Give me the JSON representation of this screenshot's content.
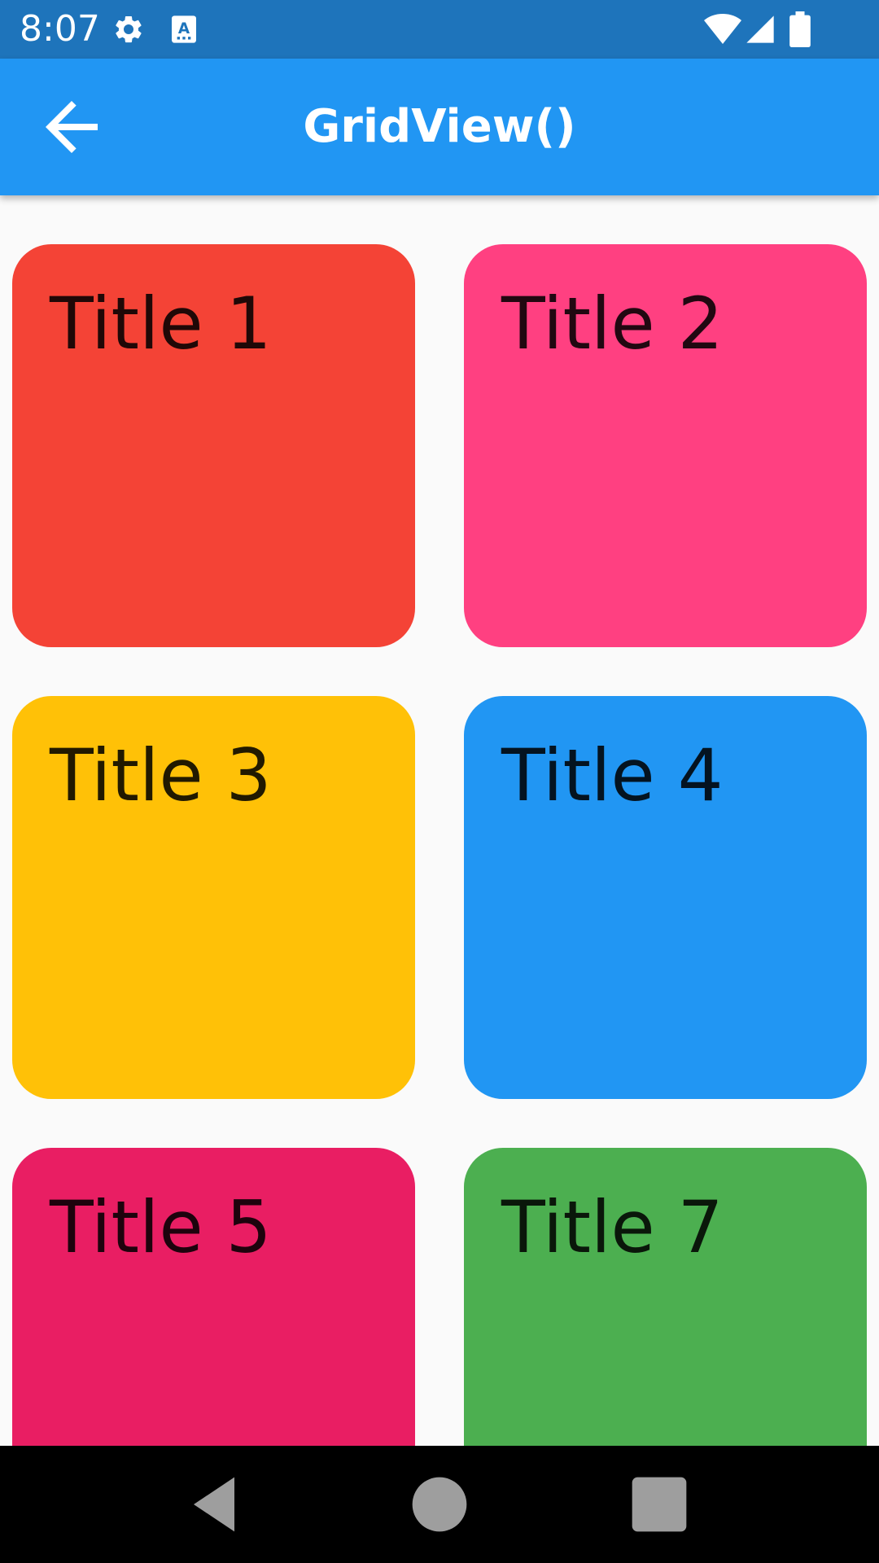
{
  "status_bar": {
    "time": "8:07",
    "background": "#1e74bb",
    "icons": [
      "gear-icon",
      "text-a-icon",
      "wifi-icon",
      "signal-icon",
      "battery-icon"
    ]
  },
  "app_bar": {
    "title": "GridView()",
    "background": "#2196f3",
    "back_icon": "arrow-left-icon"
  },
  "grid": {
    "tiles": [
      {
        "title": "Title 1",
        "color": "#f44336"
      },
      {
        "title": "Title 2",
        "color": "#ff4081"
      },
      {
        "title": "Title 3",
        "color": "#ffc107"
      },
      {
        "title": "Title 4",
        "color": "#2196f3"
      },
      {
        "title": "Title 5",
        "color": "#e91e63"
      },
      {
        "title": "Title 7",
        "color": "#4caf50"
      }
    ]
  },
  "nav_bar": {
    "buttons": [
      "back-triangle-icon",
      "home-circle-icon",
      "recents-square-icon"
    ]
  }
}
